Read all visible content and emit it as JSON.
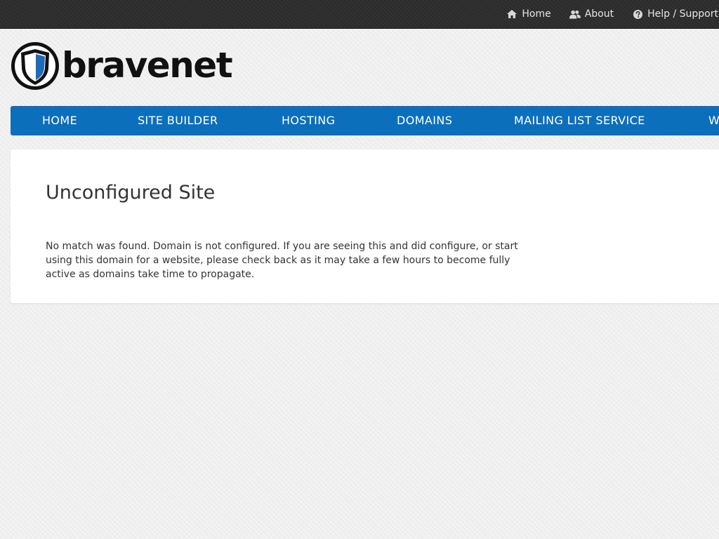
{
  "topbar": {
    "links": [
      {
        "label": "Home",
        "icon": "home-icon"
      },
      {
        "label": "About",
        "icon": "users-icon"
      },
      {
        "label": "Help / Support",
        "icon": "question-circle-icon"
      }
    ]
  },
  "logo": {
    "text": "bravenet",
    "icon": "shield-logo-icon"
  },
  "main_nav": {
    "items": [
      {
        "label": "HOME"
      },
      {
        "label": "SITE BUILDER"
      },
      {
        "label": "HOSTING"
      },
      {
        "label": "DOMAINS"
      },
      {
        "label": "MAILING LIST SERVICE"
      },
      {
        "label": "W"
      }
    ]
  },
  "content": {
    "title": "Unconfigured Site",
    "message": "No match was found. Domain is not configured. If you are seeing this and did configure, or start using this domain for a website, please check back as it may take a few hours to become fully active as domains take time to propagate."
  },
  "colors": {
    "topbar_bg": "#2b2b2b",
    "nav_bg": "#0c6fbb",
    "logo_blue": "#1e6bb8",
    "text": "#333333"
  }
}
